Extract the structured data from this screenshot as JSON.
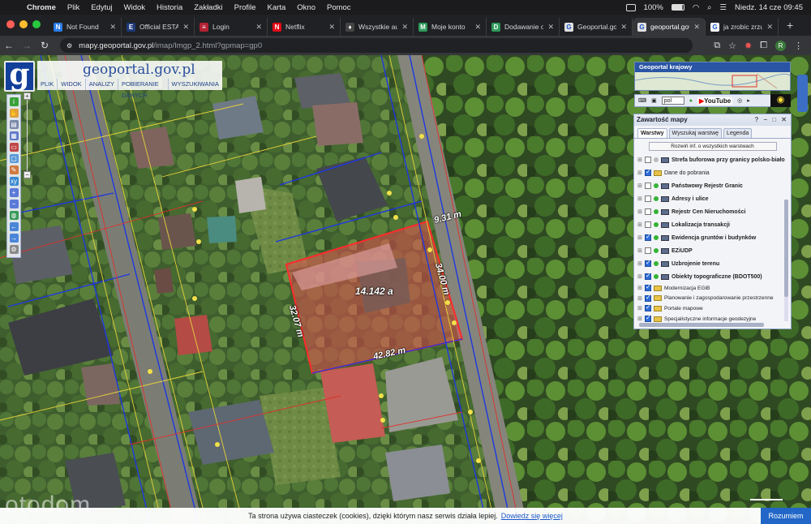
{
  "menubar": {
    "app": "Chrome",
    "menus": [
      "Plik",
      "Edytuj",
      "Widok",
      "Historia",
      "Zakładki",
      "Profile",
      "Karta",
      "Okno",
      "Pomoc"
    ],
    "battery": "100%",
    "clock": "Niedz. 14 cze 09:45"
  },
  "tabs": [
    {
      "title": "Not Found",
      "fav_color": "#2b7de9",
      "fav": "N"
    },
    {
      "title": "Official ESTA A",
      "fav_color": "#1d3a7a",
      "fav": "E"
    },
    {
      "title": "Login",
      "fav_color": "#b22234",
      "fav": "≡"
    },
    {
      "title": "Netflix",
      "fav_color": "#e50914",
      "fav": "N"
    },
    {
      "title": "Wszystkie auk",
      "fav_color": "#444444",
      "fav": "♦"
    },
    {
      "title": "Moje konto",
      "fav_color": "#2e9a5a",
      "fav": "M"
    },
    {
      "title": "Dodawanie og",
      "fav_color": "#2e9a5a",
      "fav": "D"
    },
    {
      "title": "Geoportal.gov",
      "fav_color": "#e0e0e0",
      "fav": "G"
    },
    {
      "title": "geoportal.gov",
      "fav_color": "#e0e0e0",
      "fav": "G",
      "active": true
    },
    {
      "title": "ja zrobic zrzu",
      "fav_color": "#ffffff",
      "fav": "G"
    }
  ],
  "url": {
    "host": "mapy.geoportal.gov.pl",
    "path": "/imap/Imgp_2.html?gpmap=gp0"
  },
  "profile_initial": "R",
  "geoportal": {
    "title": "geoportal.gov.pl",
    "nav": [
      "PLIK",
      "WIDOK",
      "ANALIZY",
      "POBIERANIE DANYCH",
      "WYSZUKIWANIA"
    ]
  },
  "minimap": {
    "caption": "Geoportal krajowy"
  },
  "lang_select": "pol",
  "youtube": "YouTube",
  "panel": {
    "title": "Zawartość mapy",
    "tabs": [
      "Warstwy",
      "Wyszukaj warstwę",
      "Legenda"
    ],
    "expand_all": "Rozwiń inf. o wszystkich warstwach",
    "layers": [
      {
        "label": "Strefa buforowa przy granicy polsko-biało",
        "checked": false,
        "bold": true,
        "kind": "service",
        "status": "grey"
      },
      {
        "label": "Dane do pobrania",
        "checked": true,
        "bold": false,
        "kind": "folder",
        "status": "none"
      },
      {
        "label": "Państwowy Rejestr Granic",
        "checked": false,
        "bold": true,
        "kind": "service",
        "status": "green"
      },
      {
        "label": "Adresy i ulice",
        "checked": false,
        "bold": true,
        "kind": "service",
        "status": "green"
      },
      {
        "label": "Rejestr Cen Nieruchomości",
        "checked": false,
        "bold": true,
        "kind": "service",
        "status": "green"
      },
      {
        "label": "Lokalizacja transakcji",
        "checked": false,
        "bold": true,
        "kind": "service",
        "status": "green"
      },
      {
        "label": "Ewidencja gruntów i budynków",
        "checked": true,
        "bold": true,
        "kind": "service",
        "status": "green"
      },
      {
        "label": "EZiUDP",
        "checked": false,
        "bold": true,
        "kind": "service",
        "status": "green"
      },
      {
        "label": "Uzbrojenie terenu",
        "checked": true,
        "bold": true,
        "kind": "service",
        "status": "green"
      },
      {
        "label": "Obiekty topograficzne (BDOT500)",
        "checked": true,
        "bold": true,
        "kind": "service",
        "status": "green"
      },
      {
        "label": "Modernizacja EGiB",
        "checked": true,
        "bold": false,
        "kind": "folder",
        "status": "none",
        "small": true
      },
      {
        "label": "Planowanie i zagospodarowanie przestrzenne",
        "checked": true,
        "bold": false,
        "kind": "folder",
        "status": "none",
        "small": true
      },
      {
        "label": "Portale mapowe",
        "checked": true,
        "bold": false,
        "kind": "folder",
        "status": "none",
        "small": true
      },
      {
        "label": "Specjalistyczne informacje geodezyjne",
        "checked": true,
        "bold": false,
        "kind": "folder",
        "status": "none",
        "small": true
      }
    ]
  },
  "parcel": {
    "area": "14.142 a",
    "edges": [
      "9.31 m",
      "34.00 m",
      "32.07 m",
      "42.82 m"
    ]
  },
  "cookie": {
    "text": "Ta strona używa ciasteczek (cookies), dzięki którym nasz serwis działa lepiej.",
    "link": "Dowiedz się więcej",
    "accept": "Rozumiem"
  },
  "watermark": "otodom"
}
